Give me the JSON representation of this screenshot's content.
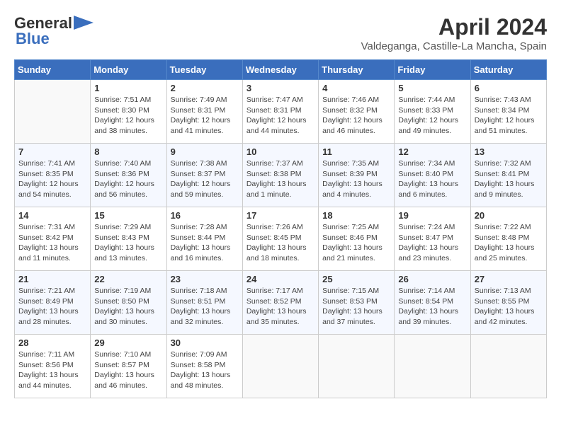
{
  "header": {
    "logo_line1": "General",
    "logo_line2": "Blue",
    "title": "April 2024",
    "subtitle": "Valdeganga, Castille-La Mancha, Spain"
  },
  "weekdays": [
    "Sunday",
    "Monday",
    "Tuesday",
    "Wednesday",
    "Thursday",
    "Friday",
    "Saturday"
  ],
  "weeks": [
    [
      {
        "day": "",
        "sunrise": "",
        "sunset": "",
        "daylight": ""
      },
      {
        "day": "1",
        "sunrise": "Sunrise: 7:51 AM",
        "sunset": "Sunset: 8:30 PM",
        "daylight": "Daylight: 12 hours and 38 minutes."
      },
      {
        "day": "2",
        "sunrise": "Sunrise: 7:49 AM",
        "sunset": "Sunset: 8:31 PM",
        "daylight": "Daylight: 12 hours and 41 minutes."
      },
      {
        "day": "3",
        "sunrise": "Sunrise: 7:47 AM",
        "sunset": "Sunset: 8:31 PM",
        "daylight": "Daylight: 12 hours and 44 minutes."
      },
      {
        "day": "4",
        "sunrise": "Sunrise: 7:46 AM",
        "sunset": "Sunset: 8:32 PM",
        "daylight": "Daylight: 12 hours and 46 minutes."
      },
      {
        "day": "5",
        "sunrise": "Sunrise: 7:44 AM",
        "sunset": "Sunset: 8:33 PM",
        "daylight": "Daylight: 12 hours and 49 minutes."
      },
      {
        "day": "6",
        "sunrise": "Sunrise: 7:43 AM",
        "sunset": "Sunset: 8:34 PM",
        "daylight": "Daylight: 12 hours and 51 minutes."
      }
    ],
    [
      {
        "day": "7",
        "sunrise": "Sunrise: 7:41 AM",
        "sunset": "Sunset: 8:35 PM",
        "daylight": "Daylight: 12 hours and 54 minutes."
      },
      {
        "day": "8",
        "sunrise": "Sunrise: 7:40 AM",
        "sunset": "Sunset: 8:36 PM",
        "daylight": "Daylight: 12 hours and 56 minutes."
      },
      {
        "day": "9",
        "sunrise": "Sunrise: 7:38 AM",
        "sunset": "Sunset: 8:37 PM",
        "daylight": "Daylight: 12 hours and 59 minutes."
      },
      {
        "day": "10",
        "sunrise": "Sunrise: 7:37 AM",
        "sunset": "Sunset: 8:38 PM",
        "daylight": "Daylight: 13 hours and 1 minute."
      },
      {
        "day": "11",
        "sunrise": "Sunrise: 7:35 AM",
        "sunset": "Sunset: 8:39 PM",
        "daylight": "Daylight: 13 hours and 4 minutes."
      },
      {
        "day": "12",
        "sunrise": "Sunrise: 7:34 AM",
        "sunset": "Sunset: 8:40 PM",
        "daylight": "Daylight: 13 hours and 6 minutes."
      },
      {
        "day": "13",
        "sunrise": "Sunrise: 7:32 AM",
        "sunset": "Sunset: 8:41 PM",
        "daylight": "Daylight: 13 hours and 9 minutes."
      }
    ],
    [
      {
        "day": "14",
        "sunrise": "Sunrise: 7:31 AM",
        "sunset": "Sunset: 8:42 PM",
        "daylight": "Daylight: 13 hours and 11 minutes."
      },
      {
        "day": "15",
        "sunrise": "Sunrise: 7:29 AM",
        "sunset": "Sunset: 8:43 PM",
        "daylight": "Daylight: 13 hours and 13 minutes."
      },
      {
        "day": "16",
        "sunrise": "Sunrise: 7:28 AM",
        "sunset": "Sunset: 8:44 PM",
        "daylight": "Daylight: 13 hours and 16 minutes."
      },
      {
        "day": "17",
        "sunrise": "Sunrise: 7:26 AM",
        "sunset": "Sunset: 8:45 PM",
        "daylight": "Daylight: 13 hours and 18 minutes."
      },
      {
        "day": "18",
        "sunrise": "Sunrise: 7:25 AM",
        "sunset": "Sunset: 8:46 PM",
        "daylight": "Daylight: 13 hours and 21 minutes."
      },
      {
        "day": "19",
        "sunrise": "Sunrise: 7:24 AM",
        "sunset": "Sunset: 8:47 PM",
        "daylight": "Daylight: 13 hours and 23 minutes."
      },
      {
        "day": "20",
        "sunrise": "Sunrise: 7:22 AM",
        "sunset": "Sunset: 8:48 PM",
        "daylight": "Daylight: 13 hours and 25 minutes."
      }
    ],
    [
      {
        "day": "21",
        "sunrise": "Sunrise: 7:21 AM",
        "sunset": "Sunset: 8:49 PM",
        "daylight": "Daylight: 13 hours and 28 minutes."
      },
      {
        "day": "22",
        "sunrise": "Sunrise: 7:19 AM",
        "sunset": "Sunset: 8:50 PM",
        "daylight": "Daylight: 13 hours and 30 minutes."
      },
      {
        "day": "23",
        "sunrise": "Sunrise: 7:18 AM",
        "sunset": "Sunset: 8:51 PM",
        "daylight": "Daylight: 13 hours and 32 minutes."
      },
      {
        "day": "24",
        "sunrise": "Sunrise: 7:17 AM",
        "sunset": "Sunset: 8:52 PM",
        "daylight": "Daylight: 13 hours and 35 minutes."
      },
      {
        "day": "25",
        "sunrise": "Sunrise: 7:15 AM",
        "sunset": "Sunset: 8:53 PM",
        "daylight": "Daylight: 13 hours and 37 minutes."
      },
      {
        "day": "26",
        "sunrise": "Sunrise: 7:14 AM",
        "sunset": "Sunset: 8:54 PM",
        "daylight": "Daylight: 13 hours and 39 minutes."
      },
      {
        "day": "27",
        "sunrise": "Sunrise: 7:13 AM",
        "sunset": "Sunset: 8:55 PM",
        "daylight": "Daylight: 13 hours and 42 minutes."
      }
    ],
    [
      {
        "day": "28",
        "sunrise": "Sunrise: 7:11 AM",
        "sunset": "Sunset: 8:56 PM",
        "daylight": "Daylight: 13 hours and 44 minutes."
      },
      {
        "day": "29",
        "sunrise": "Sunrise: 7:10 AM",
        "sunset": "Sunset: 8:57 PM",
        "daylight": "Daylight: 13 hours and 46 minutes."
      },
      {
        "day": "30",
        "sunrise": "Sunrise: 7:09 AM",
        "sunset": "Sunset: 8:58 PM",
        "daylight": "Daylight: 13 hours and 48 minutes."
      },
      {
        "day": "",
        "sunrise": "",
        "sunset": "",
        "daylight": ""
      },
      {
        "day": "",
        "sunrise": "",
        "sunset": "",
        "daylight": ""
      },
      {
        "day": "",
        "sunrise": "",
        "sunset": "",
        "daylight": ""
      },
      {
        "day": "",
        "sunrise": "",
        "sunset": "",
        "daylight": ""
      }
    ]
  ]
}
